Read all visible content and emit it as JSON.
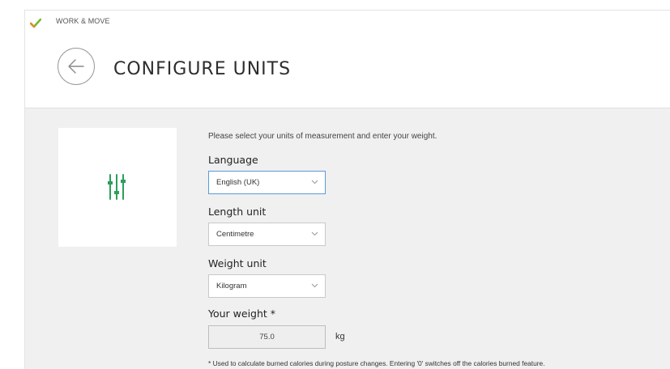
{
  "app": {
    "name": "WORK & MOVE"
  },
  "header": {
    "title": "CONFIGURE UNITS"
  },
  "form": {
    "intro": "Please select your units of measurement and enter your weight.",
    "language": {
      "label": "Language",
      "value": "English (UK)"
    },
    "length_unit": {
      "label": "Length unit",
      "value": "Centimetre"
    },
    "weight_unit": {
      "label": "Weight unit",
      "value": "Kilogram"
    },
    "weight": {
      "label": "Your weight *",
      "value": "75.0",
      "unit": "kg"
    },
    "footnote": "* Used to calculate burned calories during posture changes. Entering '0' switches off  the calories burned feature."
  },
  "colors": {
    "accent": "#2e9e5a",
    "focus": "#5b9bd5",
    "content_bg": "#f0f0f0"
  },
  "icons": {
    "back": "arrow-left-icon",
    "settings": "sliders-icon",
    "logo": "app-logo-icon"
  }
}
